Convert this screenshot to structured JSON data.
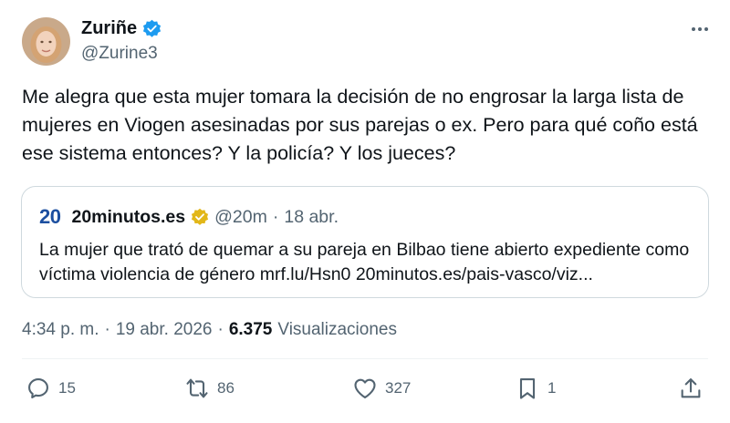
{
  "author": {
    "display_name": "Zuriñe",
    "handle": "@Zurine3",
    "verified": true
  },
  "tweet": {
    "text": "Me alegra que esta mujer tomara la decisión de no engrosar la larga lista de mujeres en Viogen asesinadas por sus parejas o ex. Pero para qué coño está ese sistema entonces? Y la policía? Y los jueces?"
  },
  "quote": {
    "logo_text": "20",
    "name": "20minutos.es",
    "handle": "@20m",
    "separator": "·",
    "date": "18 abr.",
    "text": "La mujer que trató de quemar a su pareja en Bilbao tiene abierto expediente como víctima violencia de género mrf.lu/Hsn0 20minutos.es/pais-vasco/viz..."
  },
  "meta": {
    "time": "4:34 p. m.",
    "sep1": "·",
    "date": "19 abr. 2026",
    "sep2": "·",
    "views_count": "6.375",
    "views_label": "Visualizaciones"
  },
  "actions": {
    "replies": "15",
    "retweets": "86",
    "likes": "327",
    "bookmarks": "1"
  },
  "colors": {
    "verified_blue": "#1d9bf0",
    "gold_badge": "#e2b719",
    "secondary_text": "#536471",
    "border": "#cfd9de"
  }
}
